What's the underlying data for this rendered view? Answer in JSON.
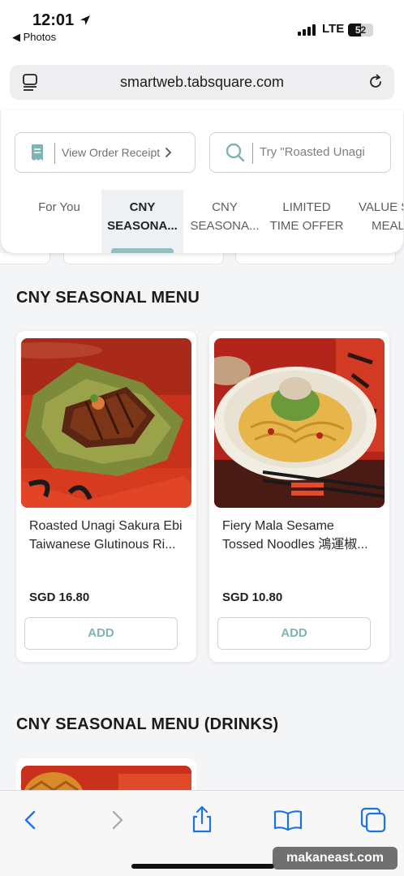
{
  "status_bar": {
    "time": "12:01",
    "back_app": "◀ Photos",
    "network": "LTE",
    "battery": "52",
    "battery_level": 0.52
  },
  "browser": {
    "url": "smartweb.tabsquare.com"
  },
  "header": {
    "receipt_label": "View Order Receipt",
    "search_placeholder": "Try \"Roasted Unagi",
    "tabs": [
      {
        "line1": "For You",
        "line2": ""
      },
      {
        "line1": "CNY",
        "line2": "SEASONA..."
      },
      {
        "line1": "CNY",
        "line2": "SEASONA..."
      },
      {
        "line1": "LIMITED",
        "line2": "TIME OFFER"
      },
      {
        "line1": "VALUE S",
        "line2": "MEAL"
      }
    ],
    "active_tab": 1
  },
  "sections": [
    {
      "title": "CNY SEASONAL MENU",
      "products": [
        {
          "name_line1": "Roasted Unagi Sakura Ebi",
          "name_line2": "Taiwanese Glutinous Ri...",
          "price": "SGD 16.80",
          "add_label": "ADD"
        },
        {
          "name_line1": "Fiery Mala Sesame",
          "name_line2": "Tossed Noodles 鴻運椒...",
          "price": "SGD 10.80",
          "add_label": "ADD"
        }
      ]
    },
    {
      "title": "CNY SEASONAL MENU (DRINKS)",
      "products": []
    }
  ],
  "watermark": "makaneast.com",
  "colors": {
    "accent": "#8fbfc0",
    "add_text": "#7fb3b4",
    "ios_blue": "#1a73e8"
  }
}
